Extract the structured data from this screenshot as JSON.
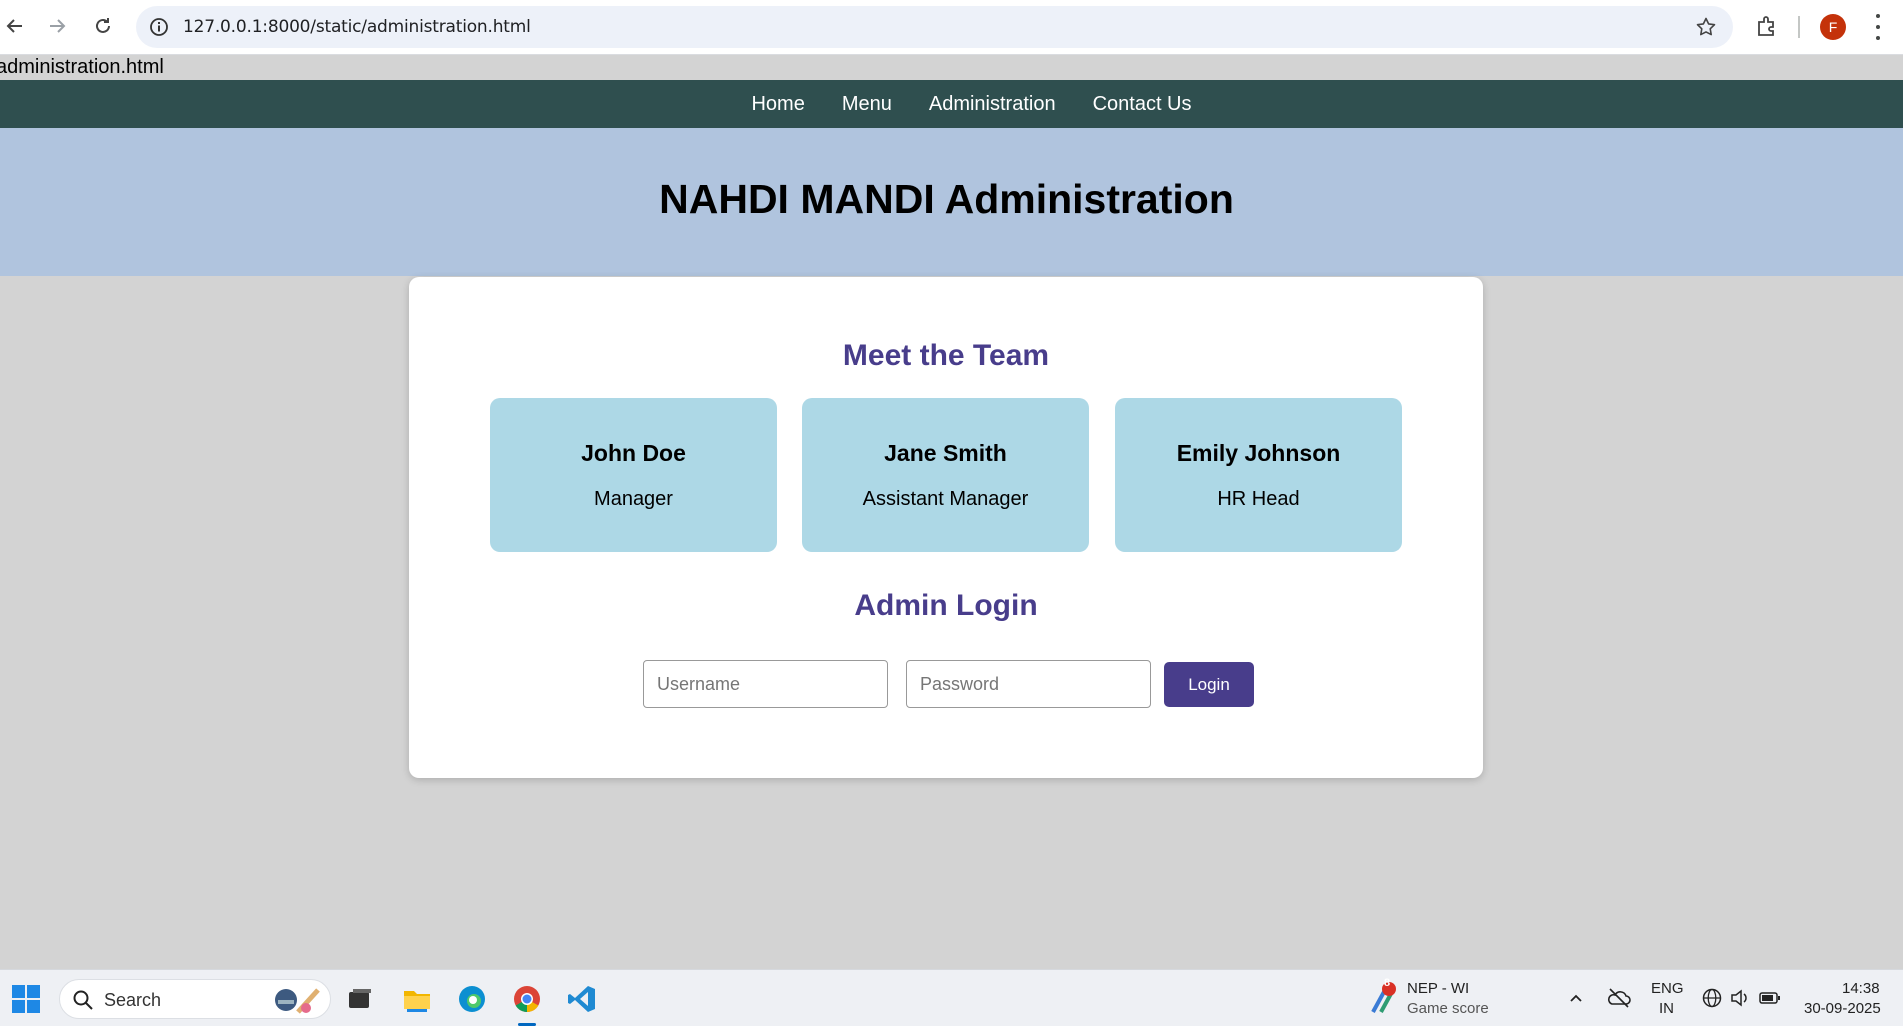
{
  "browser": {
    "url": "127.0.0.1:8000/static/administration.html",
    "avatar_letter": "F"
  },
  "page": {
    "broken_image_alt": "administration.html",
    "nav": [
      "Home",
      "Menu",
      "Administration",
      "Contact Us"
    ],
    "title": "NAHDI MANDI Administration",
    "team_heading": "Meet the Team",
    "team": [
      {
        "name": "John Doe",
        "role": "Manager"
      },
      {
        "name": "Jane Smith",
        "role": "Assistant Manager"
      },
      {
        "name": "Emily Johnson",
        "role": "HR Head"
      }
    ],
    "login_heading": "Admin Login",
    "username_placeholder": "Username",
    "password_placeholder": "Password",
    "login_label": "Login"
  },
  "taskbar": {
    "search_label": "Search",
    "widget_badge": "8",
    "widget_title": "NEP - WI",
    "widget_subtitle": "Game score",
    "lang_top": "ENG",
    "lang_bottom": "IN",
    "time": "14:38",
    "date": "30-09-2025"
  },
  "colors": {
    "nav_bg": "#2f4f4f",
    "hero_bg": "#b0c4de",
    "accent": "#483d8b",
    "member_bg": "#add8e6"
  }
}
